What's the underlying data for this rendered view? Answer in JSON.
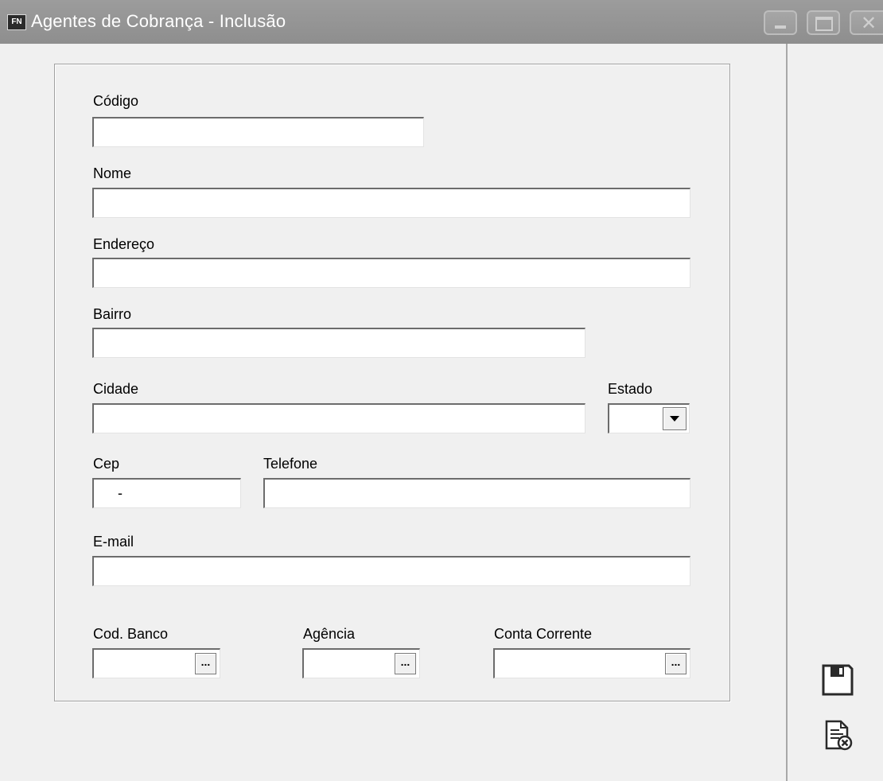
{
  "window": {
    "icon_text": "FN",
    "title": "Agentes de Cobrança - Inclusão"
  },
  "form": {
    "codigo": {
      "label": "Código",
      "value": ""
    },
    "nome": {
      "label": "Nome",
      "value": ""
    },
    "endereco": {
      "label": "Endereço",
      "value": ""
    },
    "bairro": {
      "label": "Bairro",
      "value": ""
    },
    "cidade": {
      "label": "Cidade",
      "value": ""
    },
    "estado": {
      "label": "Estado",
      "value": ""
    },
    "cep": {
      "label": "Cep",
      "value": "-"
    },
    "telefone": {
      "label": "Telefone",
      "value": ""
    },
    "email": {
      "label": "E-mail",
      "value": ""
    },
    "cod_banco": {
      "label": "Cod. Banco",
      "value": "",
      "button": "..."
    },
    "agencia": {
      "label": "Agência",
      "value": "",
      "button": "..."
    },
    "conta_corrente": {
      "label": "Conta Corrente",
      "value": "",
      "button": "..."
    }
  },
  "icons": {
    "save": "floppy-disk-icon",
    "cancel": "document-cancel-icon"
  }
}
